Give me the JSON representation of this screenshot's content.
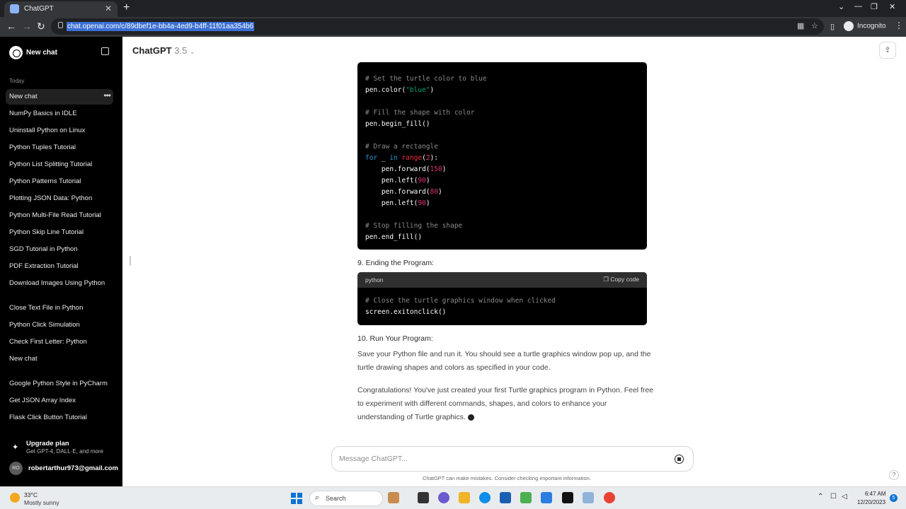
{
  "browser": {
    "tab_title": "ChatGPT",
    "url": "chat.openai.com/c/89dbef1e-bb4a-4ed9-b4ff-11f01aa354b6",
    "incognito_label": "Incognito"
  },
  "sidebar": {
    "new_chat_label": "New chat",
    "section_today": "Today",
    "items": [
      "New chat",
      "NumPy Basics in IDLE",
      "Uninstall Python on Linux",
      "Python Tuples Tutorial",
      "Python List Splitting Tutorial",
      "Python Patterns Tutorial",
      "Plotting JSON Data: Python",
      "Python Multi-File Read Tutorial",
      "Python Skip Line Tutorial",
      "SGD Tutorial in Python",
      "PDF Extraction Tutorial",
      "Download Images Using Python",
      "Close Text File in Python",
      "Python Click Simulation",
      "Check First Letter: Python",
      "New chat",
      "Google Python Style in PyCharm",
      "Get JSON Array Index",
      "Flask Click Button Tutorial"
    ],
    "upgrade_title": "Upgrade plan",
    "upgrade_sub": "Get GPT-4, DALL·E, and more",
    "user_initials": "RO",
    "user_email": "robertarthur973@gmail.com"
  },
  "header": {
    "model_name": "ChatGPT",
    "model_version": "3.5"
  },
  "content": {
    "code1": {
      "c1": "# Set the turtle color to blue",
      "c2": "# Fill the shape with color",
      "c3": "# Draw a rectangle",
      "c4": "# Stop filling the shape",
      "l_color_pre": "pen.color(",
      "l_color_arg": "\"blue\"",
      "l_color_post": ")",
      "l_begin": "pen.begin_fill()",
      "for_kw": "for",
      "for_var": " _ ",
      "in_kw": "in",
      "range_fn": "range",
      "range_arg": "2",
      "fwd1_pre": "    pen.forward(",
      "fwd1_arg": "150",
      "left1_pre": "    pen.left(",
      "left1_arg": "90",
      "fwd2_pre": "    pen.forward(",
      "fwd2_arg": "80",
      "left2_pre": "    pen.left(",
      "left2_arg": "90",
      "close_paren": ")",
      "l_end": "pen.end_fill()"
    },
    "step9": "9. Ending the Program:",
    "code2": {
      "lang": "python",
      "copy_label": "Copy code",
      "comment": "# Close the turtle graphics window when clicked",
      "line": "screen.exitonclick()"
    },
    "step10": "10. Run Your Program:",
    "para1": "Save your Python file and run it. You should see a turtle graphics window pop up, and the turtle drawing shapes and colors as specified in your code.",
    "para2": "Congratulations! You've just created your first Turtle graphics program in Python. Feel free to experiment with different commands, shapes, and colors to enhance your understanding of Turtle graphics."
  },
  "composer": {
    "placeholder": "Message ChatGPT...",
    "disclaimer": "ChatGPT can make mistakes. Consider checking important information.",
    "help": "?"
  },
  "taskbar": {
    "temperature": "33°C",
    "condition": "Mostly sunny",
    "search_label": "Search",
    "time": "6:47 AM",
    "date": "12/20/2023",
    "notification_count": "5"
  }
}
